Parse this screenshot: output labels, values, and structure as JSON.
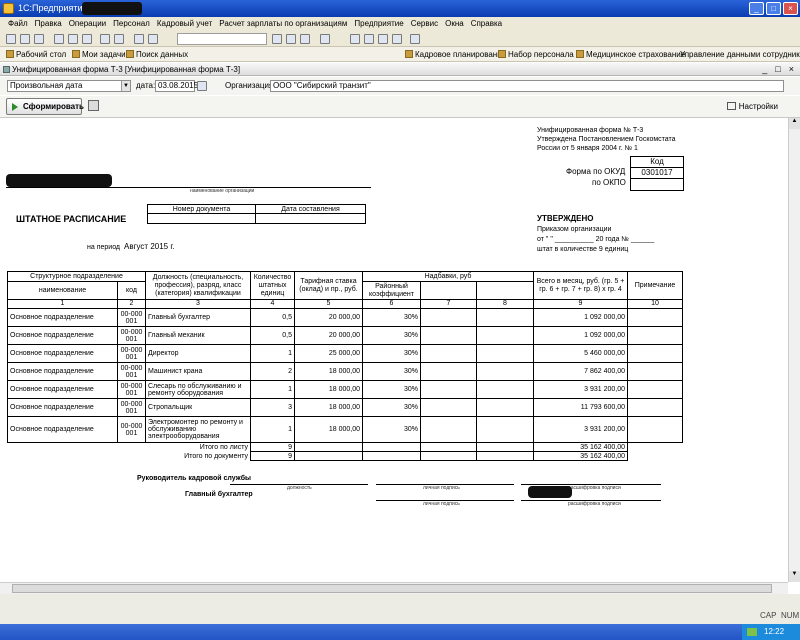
{
  "window": {
    "title": "1С:Предприятие"
  },
  "menu": [
    "Файл",
    "Правка",
    "Операции",
    "Персонал",
    "Кадровый учет",
    "Расчет зарплаты по организациям",
    "Предприятие",
    "Сервис",
    "Окна",
    "Справка"
  ],
  "panel": {
    "left": [
      "Рабочий стол",
      "Мои задачи",
      "Поиск данных"
    ],
    "right": [
      "Кадровое планирование",
      "Набор персонала",
      "Медицинское страхование",
      "Управление данными сотрудника"
    ]
  },
  "document": {
    "header_title": "Унифицированная форма Т-3 [Унифицированная форма Т-3]",
    "period_type": "Произвольная дата",
    "date_label": "дата:",
    "date_value": "03.08.2015",
    "org_label": "Организация:",
    "org_value": "ООО \"Сибирский транзит\"",
    "run_button": "Сформировать",
    "settings_label": "Настройки"
  },
  "form": {
    "approval_lines": [
      "Унифицированная форма № Т-3",
      "Утверждена Постановлением Госкомстата",
      "России от 5 января 2004 г. № 1"
    ],
    "kod_header": "Код",
    "okud_label": "Форма по ОКУД",
    "okud_value": "0301017",
    "okpo_label": "по ОКПО",
    "org_caption": "наименование организации",
    "title": "ШТАТНОЕ РАСПИСАНИЕ",
    "doc_number_label": "Номер документа",
    "doc_date_label": "Дата составления",
    "approved": "УТВЕРЖДЕНО",
    "order_line1": "Приказом организации",
    "order_line2": "от \"     \" __________ 20     года № ______",
    "order_line3": "штат в количестве 9 единиц",
    "period_label": "на период",
    "period_value": "Август 2015 г."
  },
  "table": {
    "h_struct": "Структурное подразделение",
    "h_name": "наименование",
    "h_code": "код",
    "h_position": "Должность (специальность, профессия), разряд, класс (категория) квалификации",
    "h_count": "Количество штатных единиц",
    "h_rate": "Тарифная ставка (оклад) и пр., руб.",
    "h_allow": "Надбавки, руб",
    "h_district": "Районный коэффициент",
    "h_total": "Всего в месяц, руб. (гр. 5 + гр. 6 + гр. 7 + гр. 8) х гр. 4",
    "h_note": "Примечание",
    "col_nums": [
      "1",
      "2",
      "3",
      "4",
      "5",
      "6",
      "7",
      "8",
      "9",
      "10"
    ],
    "rows": [
      {
        "dept": "Основное подразделение",
        "code": "00-000 001",
        "pos": "Главный бухгалтер",
        "count": "0,5",
        "rate": "20 000,00",
        "coef": "30%",
        "total": "1 092 000,00"
      },
      {
        "dept": "Основное подразделение",
        "code": "00-000 001",
        "pos": "Главный механик",
        "count": "0,5",
        "rate": "20 000,00",
        "coef": "30%",
        "total": "1 092 000,00"
      },
      {
        "dept": "Основное подразделение",
        "code": "00-000 001",
        "pos": "Директор",
        "count": "1",
        "rate": "25 000,00",
        "coef": "30%",
        "total": "5 460 000,00"
      },
      {
        "dept": "Основное подразделение",
        "code": "00-000 001",
        "pos": "Машинист крана",
        "count": "2",
        "rate": "18 000,00",
        "coef": "30%",
        "total": "7 862 400,00"
      },
      {
        "dept": "Основное подразделение",
        "code": "00-000 001",
        "pos": "Слесарь по обслуживанию и ремонту оборудования",
        "count": "1",
        "rate": "18 000,00",
        "coef": "30%",
        "total": "3 931 200,00"
      },
      {
        "dept": "Основное подразделение",
        "code": "00-000 001",
        "pos": "Стропальщик",
        "count": "3",
        "rate": "18 000,00",
        "coef": "30%",
        "total": "11 793 600,00"
      },
      {
        "dept": "Основное подразделение",
        "code": "00-000 001",
        "pos": "Электромонтер по ремонту и обслуживанию электрооборудования",
        "count": "1",
        "rate": "18 000,00",
        "coef": "30%",
        "total": "3 931 200,00"
      }
    ],
    "total_sheet_label": "Итого по листу",
    "total_sheet_count": "9",
    "total_sheet_sum": "35 162 400,00",
    "total_doc_label": "Итого по документу",
    "total_doc_count": "9",
    "total_doc_sum": "35 162 400,00"
  },
  "signatures": {
    "hr_head": "Руководитель кадровой службы",
    "chief_accountant": "Главный бухгалтер",
    "cap_position": "должность",
    "cap_signature": "личная подпись",
    "cap_decode": "расшифровка подписи"
  },
  "status": {
    "cap": "CAP",
    "num": "NUM",
    "clock": "12:22"
  }
}
